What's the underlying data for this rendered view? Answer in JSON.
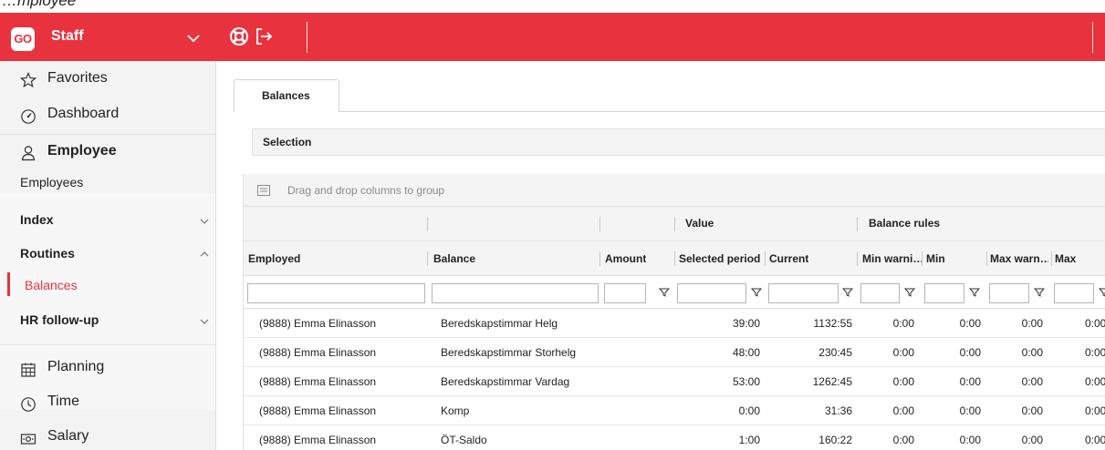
{
  "header": {
    "partial_title": "…mployee",
    "logo_text": "GO",
    "app_name": "Staff",
    "accent_color": "#e8333f"
  },
  "sidebar": {
    "favorites": "Favorites",
    "dashboard": "Dashboard",
    "employee": "Employee",
    "employees": "Employees",
    "index": "Index",
    "routines": "Routines",
    "balances": "Balances",
    "hr_followup": "HR follow-up",
    "planning": "Planning",
    "time": "Time",
    "salary": "Salary"
  },
  "tab": {
    "label": "Balances"
  },
  "selection": {
    "label": "Selection"
  },
  "grid": {
    "group_hint": "Drag and drop columns to group",
    "group_headers": {
      "value": "Value",
      "balance_rules": "Balance rules"
    },
    "columns": {
      "employed": "Employed",
      "balance": "Balance",
      "amount": "Amount",
      "selected_period": "Selected period",
      "current": "Current",
      "min_warning": "Min warni…",
      "min": "Min",
      "max_warning": "Max warn…",
      "max": "Max"
    },
    "rows": [
      {
        "employed": "(9888) Emma Elinasson",
        "balance": "Beredskapstimmar Helg",
        "selected_period": "39:00",
        "current": "1132:55",
        "min_warning": "0:00",
        "min": "0:00",
        "max_warning": "0:00",
        "max": "0:00"
      },
      {
        "employed": "(9888) Emma Elinasson",
        "balance": "Beredskapstimmar Storhelg",
        "selected_period": "48:00",
        "current": "230:45",
        "min_warning": "0:00",
        "min": "0:00",
        "max_warning": "0:00",
        "max": "0:00"
      },
      {
        "employed": "(9888) Emma Elinasson",
        "balance": "Beredskapstimmar Vardag",
        "selected_period": "53:00",
        "current": "1262:45",
        "min_warning": "0:00",
        "min": "0:00",
        "max_warning": "0:00",
        "max": "0:00"
      },
      {
        "employed": "(9888) Emma Elinasson",
        "balance": "Komp",
        "selected_period": "0:00",
        "current": "31:36",
        "min_warning": "0:00",
        "min": "0:00",
        "max_warning": "0:00",
        "max": "0:00"
      },
      {
        "employed": "(9888) Emma Elinasson",
        "balance": "ÖT-Saldo",
        "selected_period": "1:00",
        "current": "160:22",
        "min_warning": "0:00",
        "min": "0:00",
        "max_warning": "0:00",
        "max": "0:00"
      }
    ]
  }
}
